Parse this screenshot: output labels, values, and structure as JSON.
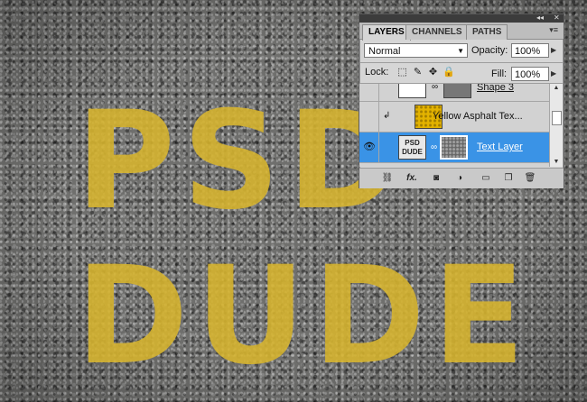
{
  "canvas": {
    "line1": "PSD",
    "line2": "DUDE",
    "stencil_color": "#d8b52e"
  },
  "panel": {
    "tabs": [
      "LAYERS",
      "CHANNELS",
      "PATHS"
    ],
    "active_tab": "LAYERS",
    "blend_mode": "Normal",
    "opacity_label": "Opacity:",
    "opacity_value": "100%",
    "lock_label": "Lock:",
    "fill_label": "Fill:",
    "fill_value": "100%",
    "layers": [
      {
        "name": "Shape 3",
        "visible": false,
        "selected": false
      },
      {
        "name": "Yellow Asphalt Tex...",
        "visible": false,
        "selected": false,
        "clipped": true
      },
      {
        "name": "Text Layer",
        "visible": true,
        "selected": true,
        "thumb_text": "PSD DUDE"
      }
    ],
    "icons": {
      "collapse": "double-right-arrow",
      "close": "close-x",
      "menu": "panel-menu",
      "footer": [
        "link-layers-icon",
        "fx-icon",
        "add-mask-icon",
        "adjustment-layer-icon",
        "new-group-icon",
        "new-layer-icon",
        "trash-icon"
      ]
    },
    "footer_fx": "fx."
  },
  "colors": {
    "selection": "#3a93e6",
    "panel_bg": "#d6d6d6"
  }
}
